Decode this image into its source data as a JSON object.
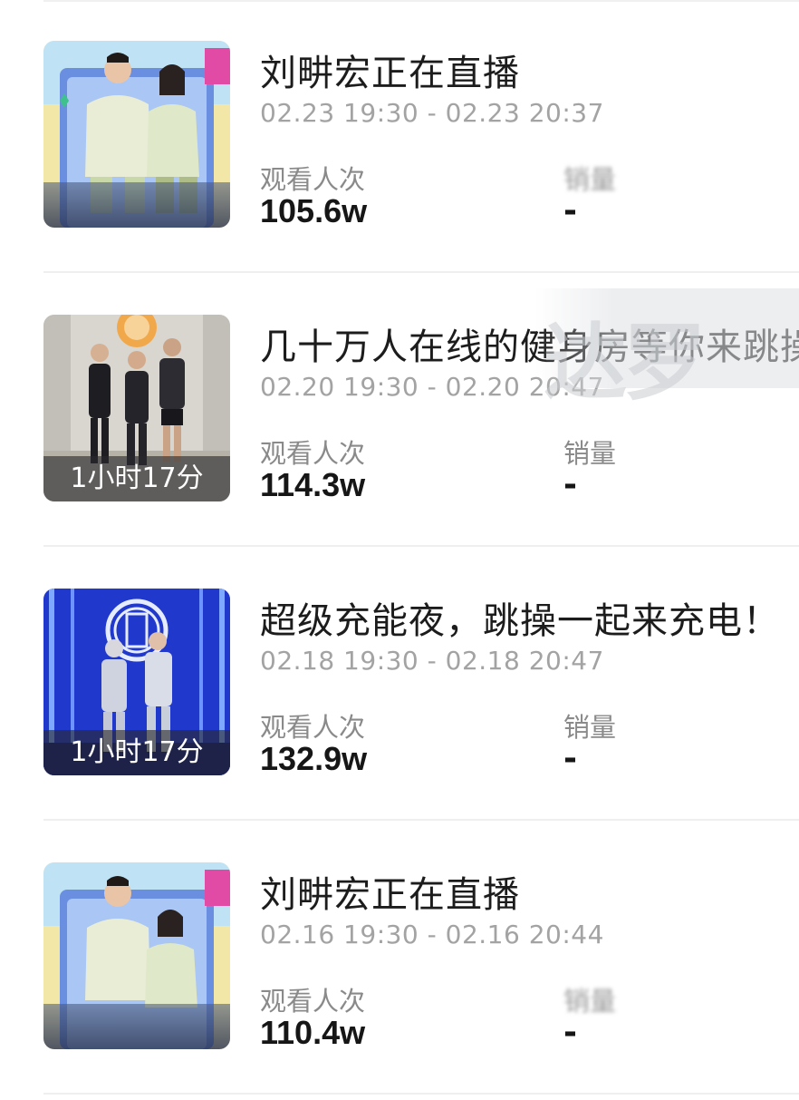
{
  "watermark": "达罗",
  "streams": [
    {
      "title": "刘畊宏正在直播",
      "time_range": "02.23 19:30 - 02.23 20:37",
      "views_label": "观看人次",
      "views_value": "105.6w",
      "sales_label": "销量",
      "sales_value": "-",
      "duration": "",
      "sales_blurred": true
    },
    {
      "title": "几十万人在线的健身房等你来跳操",
      "time_range": "02.20 19:30 - 02.20 20:47",
      "views_label": "观看人次",
      "views_value": "114.3w",
      "sales_label": "销量",
      "sales_value": "-",
      "duration": "1小时17分",
      "sales_blurred": false
    },
    {
      "title": "超级充能夜，跳操一起来充电！",
      "time_range": "02.18 19:30 - 02.18 20:47",
      "views_label": "观看人次",
      "views_value": "132.9w",
      "sales_label": "销量",
      "sales_value": "-",
      "duration": "1小时17分",
      "sales_blurred": false
    },
    {
      "title": "刘畊宏正在直播",
      "time_range": "02.16 19:30 - 02.16 20:44",
      "views_label": "观看人次",
      "views_value": "110.4w",
      "sales_label": "销量",
      "sales_value": "-",
      "duration": "",
      "sales_blurred": true
    }
  ]
}
